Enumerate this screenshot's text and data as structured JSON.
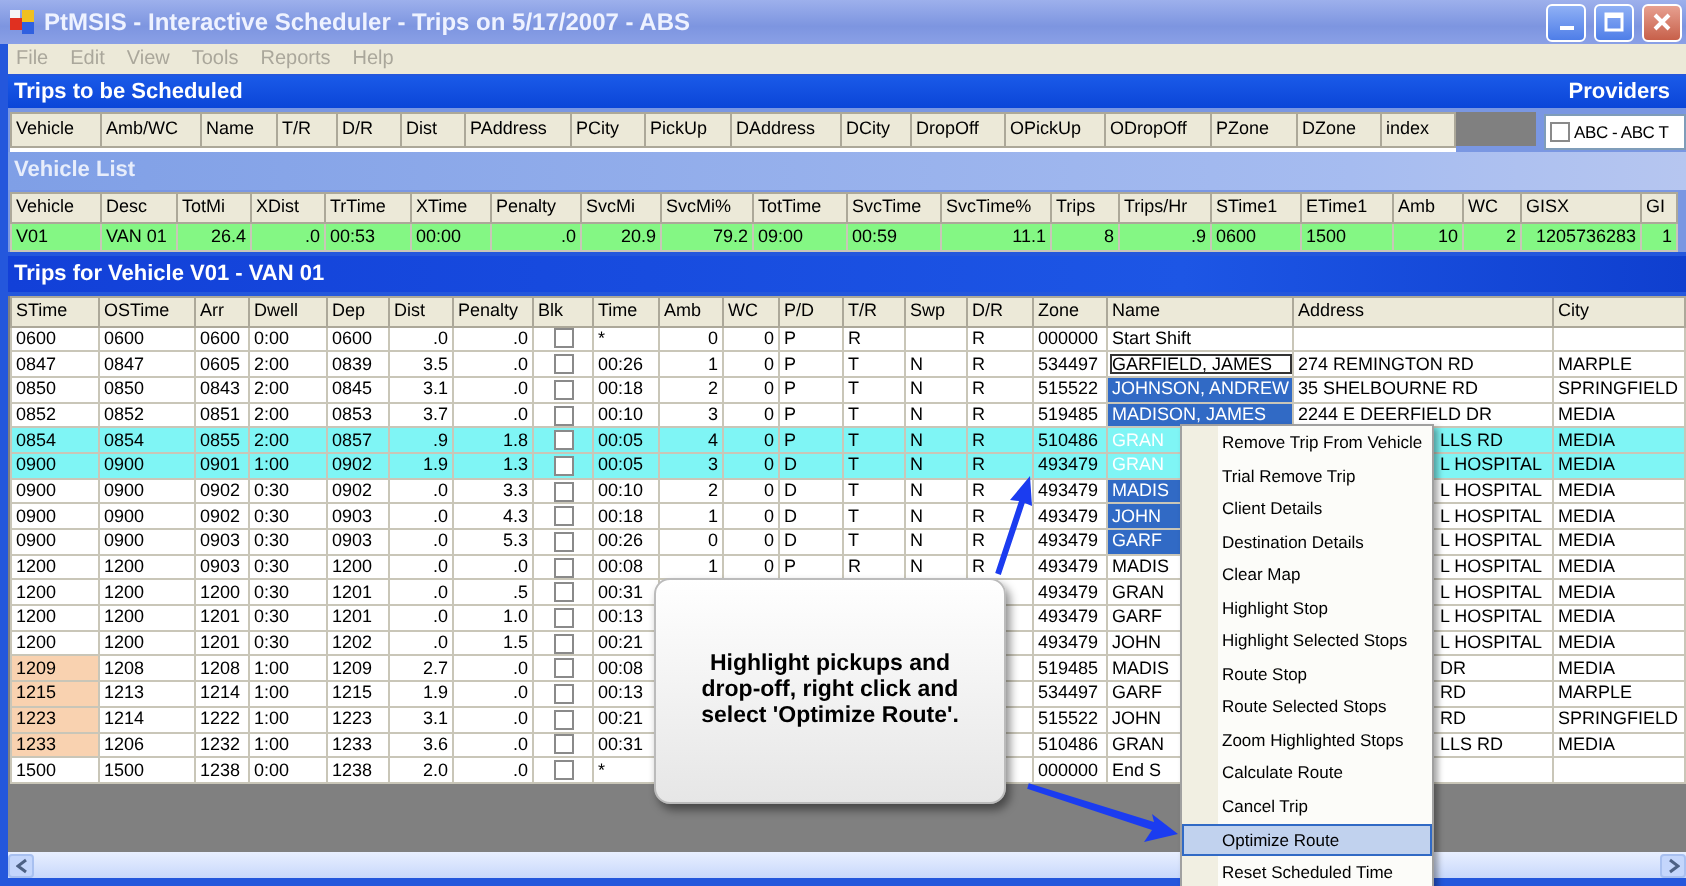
{
  "window": {
    "title": "PtMSIS - Interactive Scheduler - Trips on 5/17/2007 - ABS"
  },
  "menu": [
    {
      "label": "File",
      "disabled": true
    },
    {
      "label": "Edit",
      "disabled": true
    },
    {
      "label": "View",
      "disabled": true
    },
    {
      "label": "Tools",
      "disabled": true
    },
    {
      "label": "Reports",
      "disabled": true
    },
    {
      "label": "Help",
      "disabled": true
    }
  ],
  "trips_to_be_scheduled": {
    "title": "Trips to be Scheduled",
    "columns": [
      "Vehicle",
      "Amb/WC",
      "Name",
      "T/R",
      "D/R",
      "Dist",
      "PAddress",
      "PCity",
      "PickUp",
      "DAddress",
      "DCity",
      "DropOff",
      "OPickUp",
      "ODropOff",
      "PZone",
      "DZone",
      "index"
    ]
  },
  "providers": {
    "title": "Providers",
    "items": [
      {
        "label": "ABC - ABC T",
        "checked": false
      }
    ]
  },
  "vehicle_list": {
    "title": "Vehicle List",
    "columns": [
      "Vehicle",
      "Desc",
      "TotMi",
      "XDist",
      "TrTime",
      "XTime",
      "Penalty",
      "SvcMi",
      "SvcMi%",
      "TotTime",
      "SvcTime",
      "SvcTime%",
      "Trips",
      "Trips/Hr",
      "STime1",
      "ETime1",
      "Amb",
      "WC",
      "GISX",
      "GI"
    ],
    "rows": [
      {
        "selected": true,
        "cells": [
          "V01",
          "VAN 01",
          "26.4",
          ".0",
          "00:53",
          "00:00",
          ".0",
          "20.9",
          "79.2",
          "09:00",
          "00:59",
          "11.1",
          "8",
          ".9",
          "0600",
          "1500",
          "10",
          "2",
          "1205736283",
          "1"
        ]
      }
    ]
  },
  "trips": {
    "title": "Trips for Vehicle V01 - VAN 01",
    "columns": [
      "STime",
      "OSTime",
      "Arr",
      "Dwell",
      "Dep",
      "Dist",
      "Penalty",
      "Blk",
      "Time",
      "Amb",
      "WC",
      "P/D",
      "T/R",
      "Swp",
      "D/R",
      "Zone",
      "Name",
      "Address",
      "City"
    ],
    "rows": [
      {
        "highlighted": false,
        "late": false,
        "name_selected": false,
        "name_focused": false,
        "blk_checked": false,
        "cells": [
          "0600",
          "0600",
          "0600",
          "0:00",
          "0600",
          ".0",
          ".0",
          null,
          "*",
          "0",
          "0",
          "P",
          "R",
          null,
          "R",
          "000000",
          "Start Shift",
          null,
          null
        ]
      },
      {
        "highlighted": false,
        "late": false,
        "name_selected": false,
        "name_focused": true,
        "blk_checked": false,
        "cells": [
          "0847",
          "0847",
          "0605",
          "2:00",
          "0839",
          "3.5",
          ".0",
          null,
          "00:26",
          "1",
          "0",
          "P",
          "T",
          "N",
          "R",
          "534497",
          "GARFIELD, JAMES",
          "274 REMINGTON RD",
          "MARPLE"
        ]
      },
      {
        "highlighted": false,
        "late": false,
        "name_selected": true,
        "name_focused": false,
        "blk_checked": false,
        "cells": [
          "0850",
          "0850",
          "0843",
          "2:00",
          "0845",
          "3.1",
          ".0",
          null,
          "00:18",
          "2",
          "0",
          "P",
          "T",
          "N",
          "R",
          "515522",
          "JOHNSON, ANDREW",
          "35 SHELBOURNE RD",
          "SPRINGFIELD"
        ]
      },
      {
        "highlighted": false,
        "late": false,
        "name_selected": true,
        "name_focused": false,
        "blk_checked": false,
        "cells": [
          "0852",
          "0852",
          "0851",
          "2:00",
          "0853",
          "3.7",
          ".0",
          null,
          "00:10",
          "3",
          "0",
          "P",
          "T",
          "N",
          "R",
          "519485",
          "MADISON, JAMES",
          "2244 E DEERFIELD DR",
          "MEDIA"
        ]
      },
      {
        "highlighted": true,
        "late": false,
        "name_selected": true,
        "name_focused": false,
        "blk_checked": false,
        "cells": [
          "0854",
          "0854",
          "0855",
          "2:00",
          "0857",
          ".9",
          "1.8",
          null,
          "00:05",
          "4",
          "0",
          "P",
          "T",
          "N",
          "R",
          "510486",
          "GRAN",
          "LLS RD",
          "MEDIA"
        ]
      },
      {
        "highlighted": true,
        "late": false,
        "name_selected": true,
        "name_focused": false,
        "blk_checked": false,
        "cells": [
          "0900",
          "0900",
          "0901",
          "1:00",
          "0902",
          "1.9",
          "1.3",
          null,
          "00:05",
          "3",
          "0",
          "D",
          "T",
          "N",
          "R",
          "493479",
          "GRAN",
          "L HOSPITAL",
          "MEDIA"
        ]
      },
      {
        "highlighted": false,
        "late": false,
        "name_selected": true,
        "name_focused": false,
        "blk_checked": false,
        "cells": [
          "0900",
          "0900",
          "0902",
          "0:30",
          "0902",
          ".0",
          "3.3",
          null,
          "00:10",
          "2",
          "0",
          "D",
          "T",
          "N",
          "R",
          "493479",
          "MADIS",
          "L HOSPITAL",
          "MEDIA"
        ]
      },
      {
        "highlighted": false,
        "late": false,
        "name_selected": true,
        "name_focused": false,
        "blk_checked": false,
        "cells": [
          "0900",
          "0900",
          "0902",
          "0:30",
          "0903",
          ".0",
          "4.3",
          null,
          "00:18",
          "1",
          "0",
          "D",
          "T",
          "N",
          "R",
          "493479",
          "JOHN",
          "L HOSPITAL",
          "MEDIA"
        ]
      },
      {
        "highlighted": false,
        "late": false,
        "name_selected": true,
        "name_focused": false,
        "blk_checked": false,
        "cells": [
          "0900",
          "0900",
          "0903",
          "0:30",
          "0903",
          ".0",
          "5.3",
          null,
          "00:26",
          "0",
          "0",
          "D",
          "T",
          "N",
          "R",
          "493479",
          "GARF",
          "L HOSPITAL",
          "MEDIA"
        ]
      },
      {
        "highlighted": false,
        "late": false,
        "name_selected": false,
        "name_focused": false,
        "blk_checked": false,
        "cells": [
          "1200",
          "1200",
          "0903",
          "0:30",
          "1200",
          ".0",
          ".0",
          null,
          "00:08",
          "1",
          "0",
          "P",
          "R",
          "N",
          "R",
          "493479",
          "MADIS",
          "L HOSPITAL",
          "MEDIA"
        ]
      },
      {
        "highlighted": false,
        "late": false,
        "name_selected": false,
        "name_focused": false,
        "blk_checked": false,
        "cells": [
          "1200",
          "1200",
          "1200",
          "0:30",
          "1201",
          ".0",
          ".5",
          null,
          "00:31",
          null,
          null,
          null,
          null,
          null,
          null,
          "493479",
          "GRAN",
          "L HOSPITAL",
          "MEDIA"
        ]
      },
      {
        "highlighted": false,
        "late": false,
        "name_selected": false,
        "name_focused": false,
        "blk_checked": false,
        "cells": [
          "1200",
          "1200",
          "1201",
          "0:30",
          "1201",
          ".0",
          "1.0",
          null,
          "00:13",
          null,
          null,
          null,
          null,
          null,
          null,
          "493479",
          "GARF",
          "L HOSPITAL",
          "MEDIA"
        ]
      },
      {
        "highlighted": false,
        "late": false,
        "name_selected": false,
        "name_focused": false,
        "blk_checked": false,
        "cells": [
          "1200",
          "1200",
          "1201",
          "0:30",
          "1202",
          ".0",
          "1.5",
          null,
          "00:21",
          null,
          null,
          null,
          null,
          null,
          null,
          "493479",
          "JOHN",
          "L HOSPITAL",
          "MEDIA"
        ]
      },
      {
        "highlighted": false,
        "late": true,
        "name_selected": false,
        "name_focused": false,
        "blk_checked": false,
        "cells": [
          "1209",
          "1208",
          "1208",
          "1:00",
          "1209",
          "2.7",
          ".0",
          null,
          "00:08",
          null,
          null,
          null,
          null,
          null,
          null,
          "519485",
          "MADIS",
          "DR",
          "MEDIA"
        ]
      },
      {
        "highlighted": false,
        "late": true,
        "name_selected": false,
        "name_focused": false,
        "blk_checked": false,
        "cells": [
          "1215",
          "1213",
          "1214",
          "1:00",
          "1215",
          "1.9",
          ".0",
          null,
          "00:13",
          null,
          null,
          null,
          null,
          null,
          null,
          "534497",
          "GARF",
          "RD",
          "MARPLE"
        ]
      },
      {
        "highlighted": false,
        "late": true,
        "name_selected": false,
        "name_focused": false,
        "blk_checked": false,
        "cells": [
          "1223",
          "1214",
          "1222",
          "1:00",
          "1223",
          "3.1",
          ".0",
          null,
          "00:21",
          null,
          null,
          null,
          null,
          null,
          null,
          "515522",
          "JOHN",
          "RD",
          "SPRINGFIELD"
        ]
      },
      {
        "highlighted": false,
        "late": true,
        "name_selected": false,
        "name_focused": false,
        "blk_checked": false,
        "cells": [
          "1233",
          "1206",
          "1232",
          "1:00",
          "1233",
          "3.6",
          ".0",
          null,
          "00:31",
          null,
          null,
          null,
          null,
          null,
          null,
          "510486",
          "GRAN",
          "LLS RD",
          "MEDIA"
        ]
      },
      {
        "highlighted": false,
        "late": false,
        "name_selected": false,
        "name_focused": false,
        "blk_checked": false,
        "cells": [
          "1500",
          "1500",
          "1238",
          "0:00",
          "1238",
          "2.0",
          ".0",
          null,
          "*",
          null,
          null,
          null,
          null,
          null,
          null,
          "000000",
          "End S",
          null,
          null
        ]
      }
    ]
  },
  "context_menu": {
    "items": [
      {
        "label": "Remove Trip From Vehicle",
        "selected": false
      },
      {
        "label": "Trial Remove Trip",
        "selected": false
      },
      {
        "label": "Client Details",
        "selected": false
      },
      {
        "label": "Destination Details",
        "selected": false
      },
      {
        "label": "Clear Map",
        "selected": false
      },
      {
        "label": "Highlight Stop",
        "selected": false
      },
      {
        "label": "Highlight Selected Stops",
        "selected": false
      },
      {
        "label": "Route Stop",
        "selected": false
      },
      {
        "label": "Route Selected Stops",
        "selected": false
      },
      {
        "label": "Zoom Highlighted Stops",
        "selected": false
      },
      {
        "label": "Calculate Route",
        "selected": false
      },
      {
        "label": "Cancel Trip",
        "selected": false
      },
      {
        "label": "Optimize Route",
        "selected": true
      },
      {
        "label": "Reset Scheduled Time",
        "selected": false
      }
    ]
  },
  "callout": {
    "text": "Highlight pickups and drop-off, right click and select 'Optimize Route'."
  }
}
